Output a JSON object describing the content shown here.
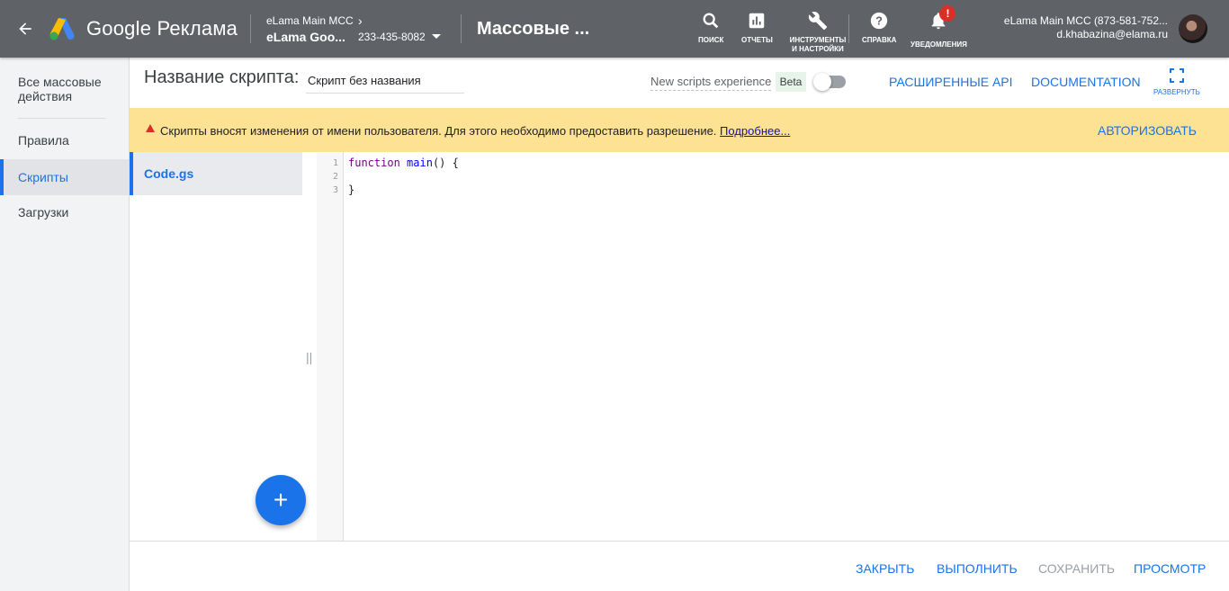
{
  "topbar": {
    "brand": "Google Реклама",
    "account_parent": "eLama Main MCC",
    "account_name": "eLama Goo...",
    "account_id": "233-435-8082",
    "page_title": "Массовые ...",
    "tools": {
      "search": "Поиск",
      "reports": "Отчеты",
      "tools_settings": "Инструменты и настройки",
      "help": "Справка",
      "notifications": "Уведомления"
    },
    "notification_badge": "!",
    "user_name": "eLama Main MCC (873-581-752...",
    "user_email": "d.khabazina@elama.ru"
  },
  "leftnav": {
    "items": [
      {
        "label": "Все массовые действия",
        "active": false
      },
      {
        "label": "Правила",
        "active": false
      },
      {
        "label": "Скрипты",
        "active": true
      },
      {
        "label": "Загрузки",
        "active": false
      }
    ]
  },
  "header": {
    "script_name_label": "Название скрипта:",
    "script_name_value": "Скрипт без названия",
    "new_experience_label": "New scripts experience",
    "beta_label": "Beta",
    "advanced_api": "РАСШИРЕННЫЕ API",
    "documentation": "DOCUMENTATION",
    "expand": "Развернуть"
  },
  "banner": {
    "text": "Скрипты вносят изменения от имени пользователя. Для этого необходимо предоставить разрешение.",
    "link": "Подробнее...",
    "action": "АВТОРИЗОВАТЬ"
  },
  "files": {
    "items": [
      {
        "name": "Code.gs"
      }
    ],
    "add_label": "+"
  },
  "editor": {
    "lines": [
      "1",
      "2",
      "3"
    ],
    "code": {
      "keyword": "function",
      "function_name": "main",
      "signature_rest": "() {",
      "closing": "}"
    }
  },
  "footer": {
    "close": "ЗАКРЫТЬ",
    "run": "ВЫПОЛНИТЬ",
    "save": "СОХРАНИТЬ",
    "preview": "ПРОСМОТР"
  },
  "colors": {
    "topbar_bg": "#5f6368",
    "accent": "#1a73e8",
    "banner_bg": "#fde293",
    "warning": "#d93025"
  }
}
